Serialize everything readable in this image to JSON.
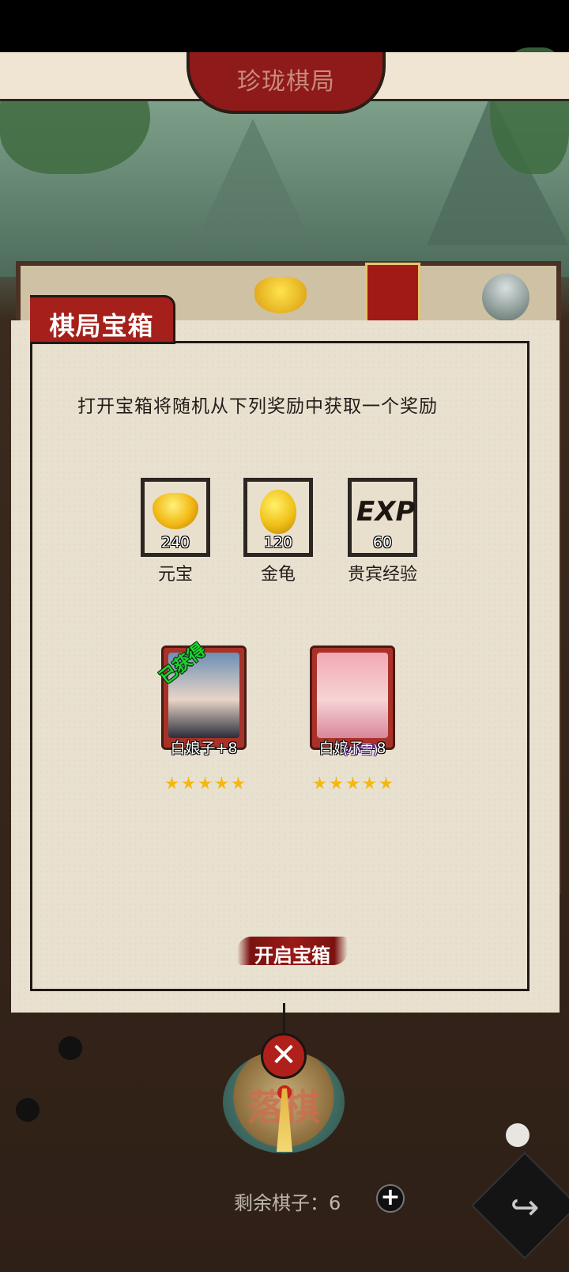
{
  "header": {
    "title": "珍珑棋局"
  },
  "modal": {
    "title": "棋局宝箱",
    "instruction": "打开宝箱将随机从下列奖励中获取一个奖励",
    "rewards": [
      {
        "name": "元宝",
        "qty": "240",
        "icon": "gold-ingot-icon"
      },
      {
        "name": "金龟",
        "qty": "120",
        "icon": "golden-turtle-icon"
      },
      {
        "name": "贵宾经验",
        "qty": "60",
        "icon": "exp-icon",
        "icon_text": "EXP"
      }
    ],
    "characters": [
      {
        "name": "白娘子+8",
        "badge": "已获得",
        "stars": 5
      },
      {
        "name": "白娘子+8",
        "nickname": "(小雪)",
        "stars": 5
      }
    ],
    "open_button": "开启宝箱",
    "close_icon": "close-icon"
  },
  "bottom": {
    "drop_button": "落棋",
    "remaining_label": "剩余棋子：",
    "remaining_count": "6",
    "plus_icon": "+",
    "share_icon": "↪"
  },
  "colors": {
    "accent_red": "#a5201b",
    "paper": "#e9e1d0",
    "gold": "#f2b814",
    "obtained_green": "#1bd42f"
  }
}
